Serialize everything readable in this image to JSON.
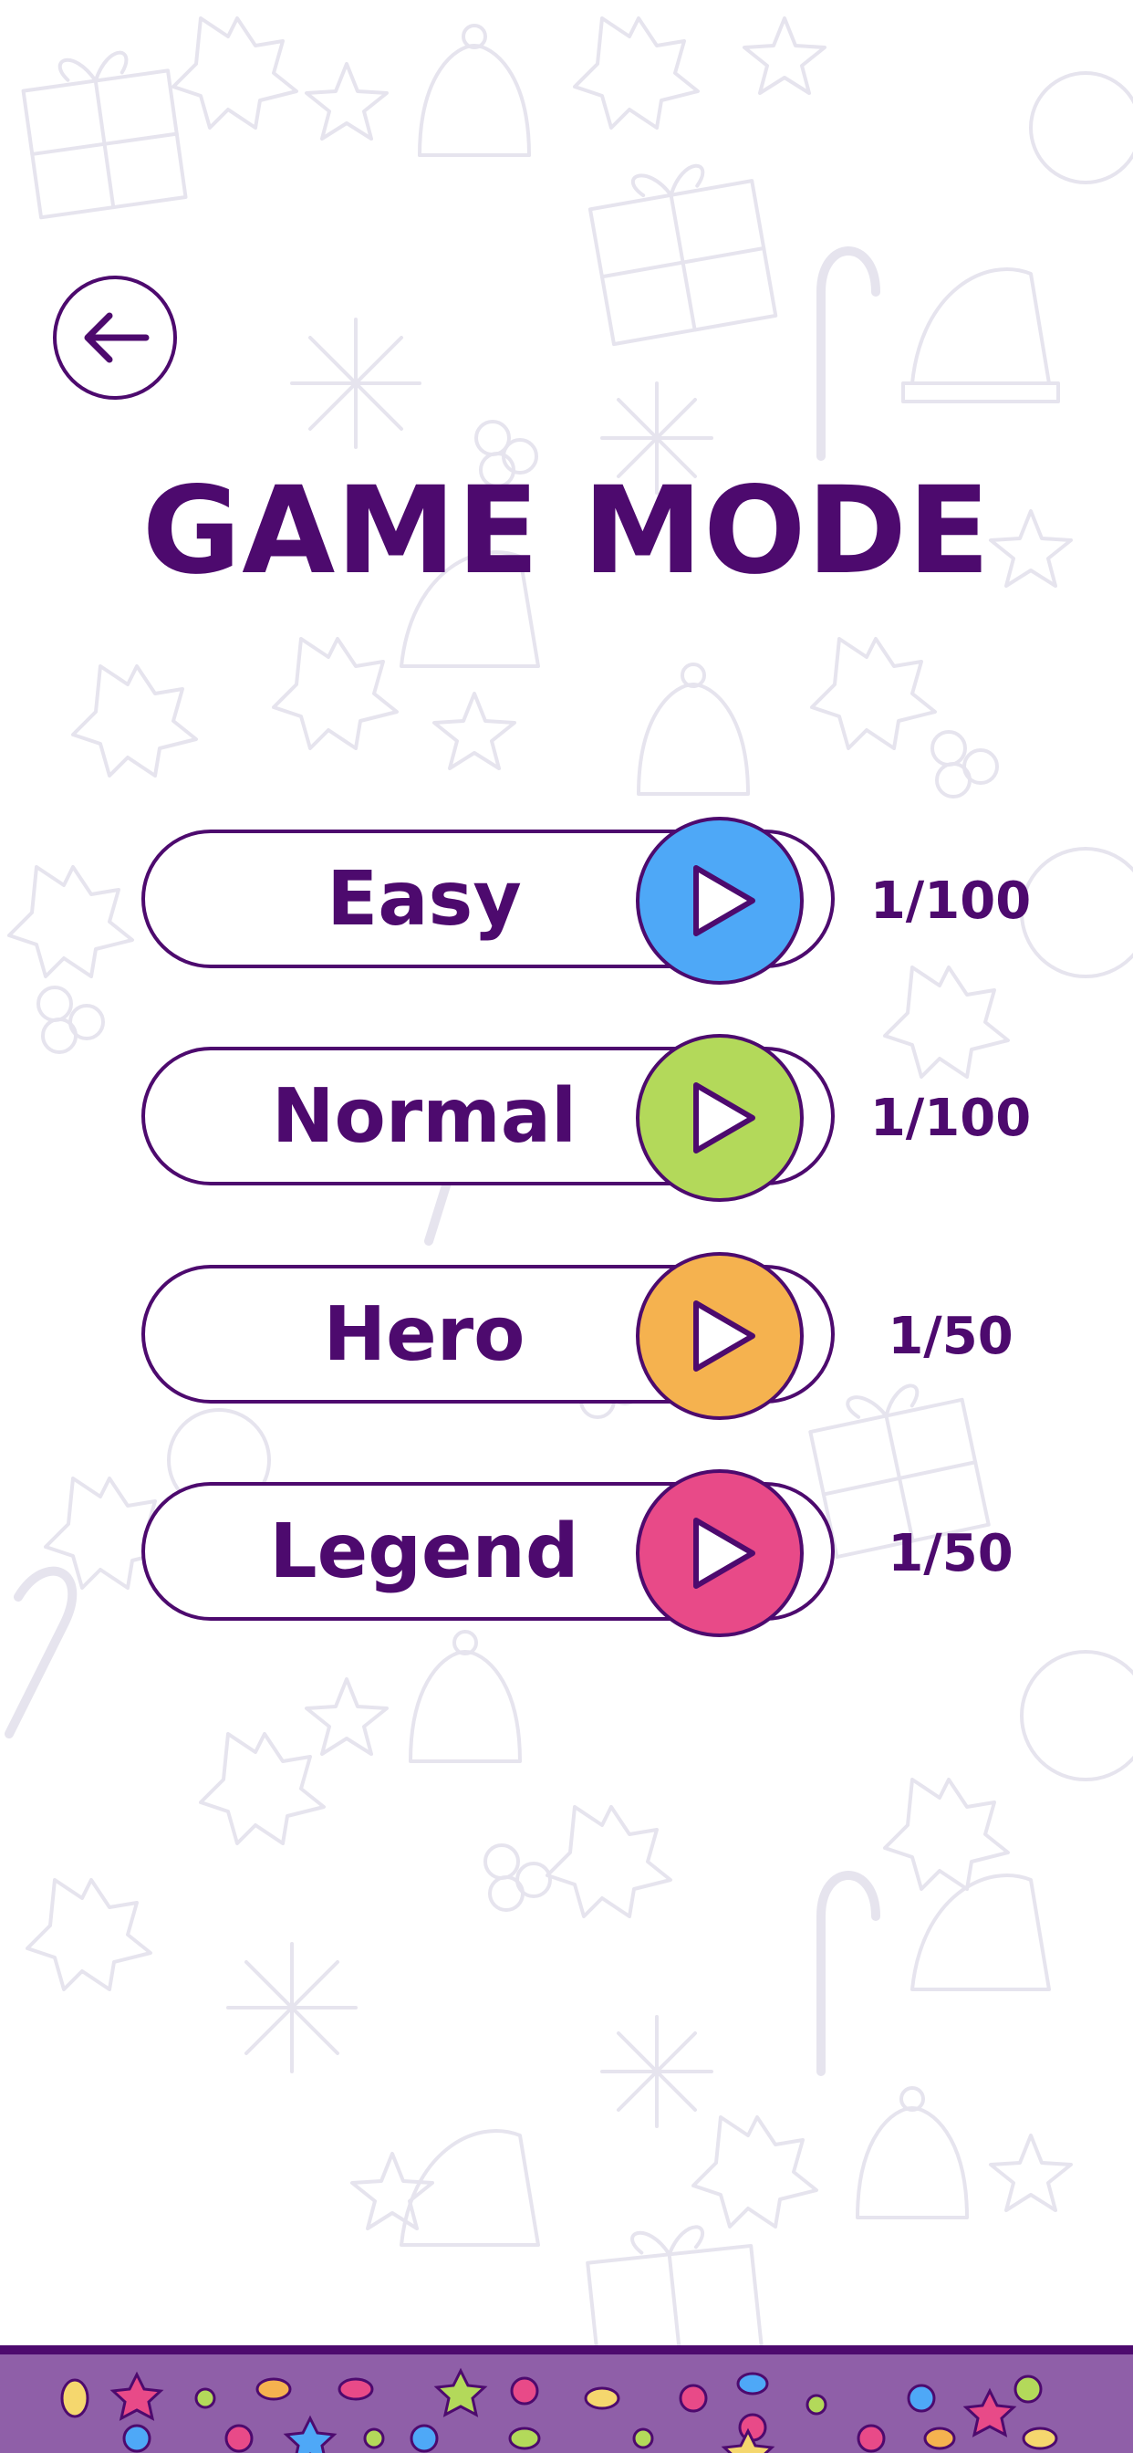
{
  "screen": {
    "title": "GAME MODE"
  },
  "header": {
    "back_icon": "arrow-left-icon"
  },
  "modes": [
    {
      "label": "Easy",
      "progress": "1/100",
      "color": "#4ea8f7"
    },
    {
      "label": "Normal",
      "progress": "1/100",
      "color": "#b3d95a"
    },
    {
      "label": "Hero",
      "progress": "1/50",
      "color": "#f5b24f"
    },
    {
      "label": "Legend",
      "progress": "1/50",
      "color": "#e84a88"
    }
  ],
  "theme": {
    "primary": "#4d0a6e",
    "footer": "#8f5fa8",
    "play_icon": "play-icon"
  }
}
